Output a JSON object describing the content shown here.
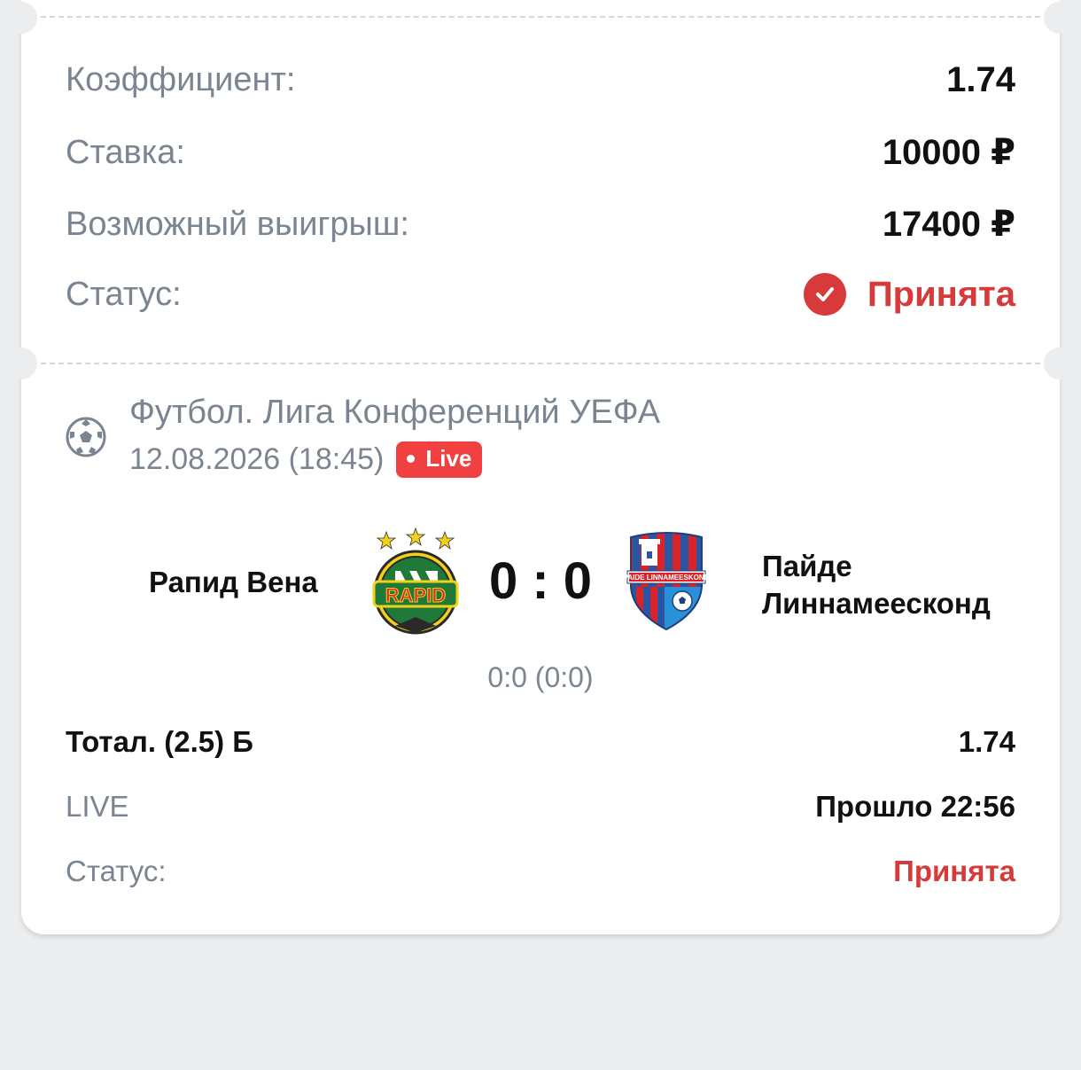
{
  "summary": {
    "coef_label": "Коэффициент:",
    "coef_value": "1.74",
    "stake_label": "Ставка:",
    "stake_value": "10000 ₽",
    "win_label": "Возможный выигрыш:",
    "win_value": "17400 ₽",
    "status_label": "Статус:",
    "status_value": "Принята"
  },
  "event": {
    "league": "Футбол. Лига Конференций УЕФА",
    "datetime": "12.08.2026 (18:45)",
    "live_badge": "Live",
    "home_team": "Рапид Вена",
    "home_logo_text": "RAPID",
    "away_team_line1": "Пайде",
    "away_team_line2": "Линнамеесконд",
    "away_logo_text": "PAIDE LINNAMEESKOND",
    "score": "0 : 0",
    "half_score": "0:0 (0:0)"
  },
  "bet": {
    "market": "Тотал. (2.5) Б",
    "odds": "1.74",
    "mode": "LIVE",
    "elapsed": "Прошло 22:56",
    "status_label": "Статус:",
    "status_value": "Принята"
  },
  "colors": {
    "accent_red": "#d63a3a",
    "live_red": "#f04040",
    "grey_text": "#7b8591",
    "background": "#ebedef"
  },
  "icons": {
    "status": "check-circle-icon",
    "sport": "football-icon"
  }
}
